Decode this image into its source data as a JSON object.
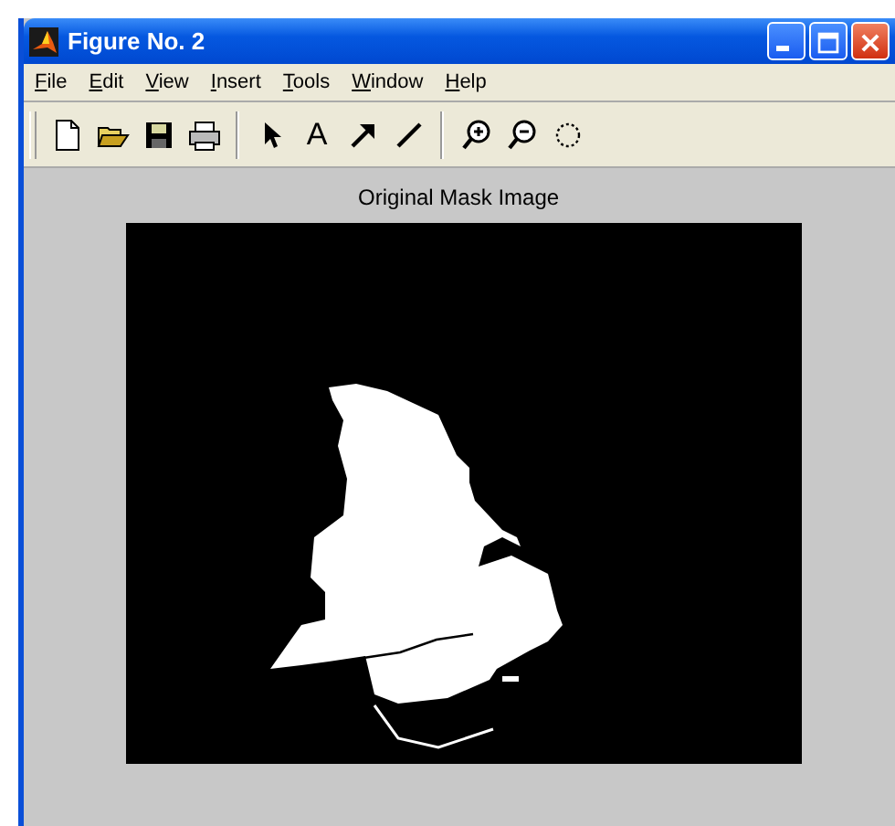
{
  "window": {
    "title": "Figure No. 2"
  },
  "menu": [
    "File",
    "Edit",
    "View",
    "Insert",
    "Tools",
    "Window",
    "Help"
  ],
  "toolbar": [
    {
      "kind": "new"
    },
    {
      "kind": "open"
    },
    {
      "kind": "save"
    },
    {
      "kind": "print"
    },
    {
      "kind": "separator"
    },
    {
      "kind": "pointer"
    },
    {
      "kind": "text",
      "label": "A"
    },
    {
      "kind": "arrow"
    },
    {
      "kind": "line"
    },
    {
      "kind": "separator"
    },
    {
      "kind": "zoom-in"
    },
    {
      "kind": "zoom-out"
    },
    {
      "kind": "rotate"
    }
  ],
  "figure": {
    "title": "Original Mask Image"
  }
}
